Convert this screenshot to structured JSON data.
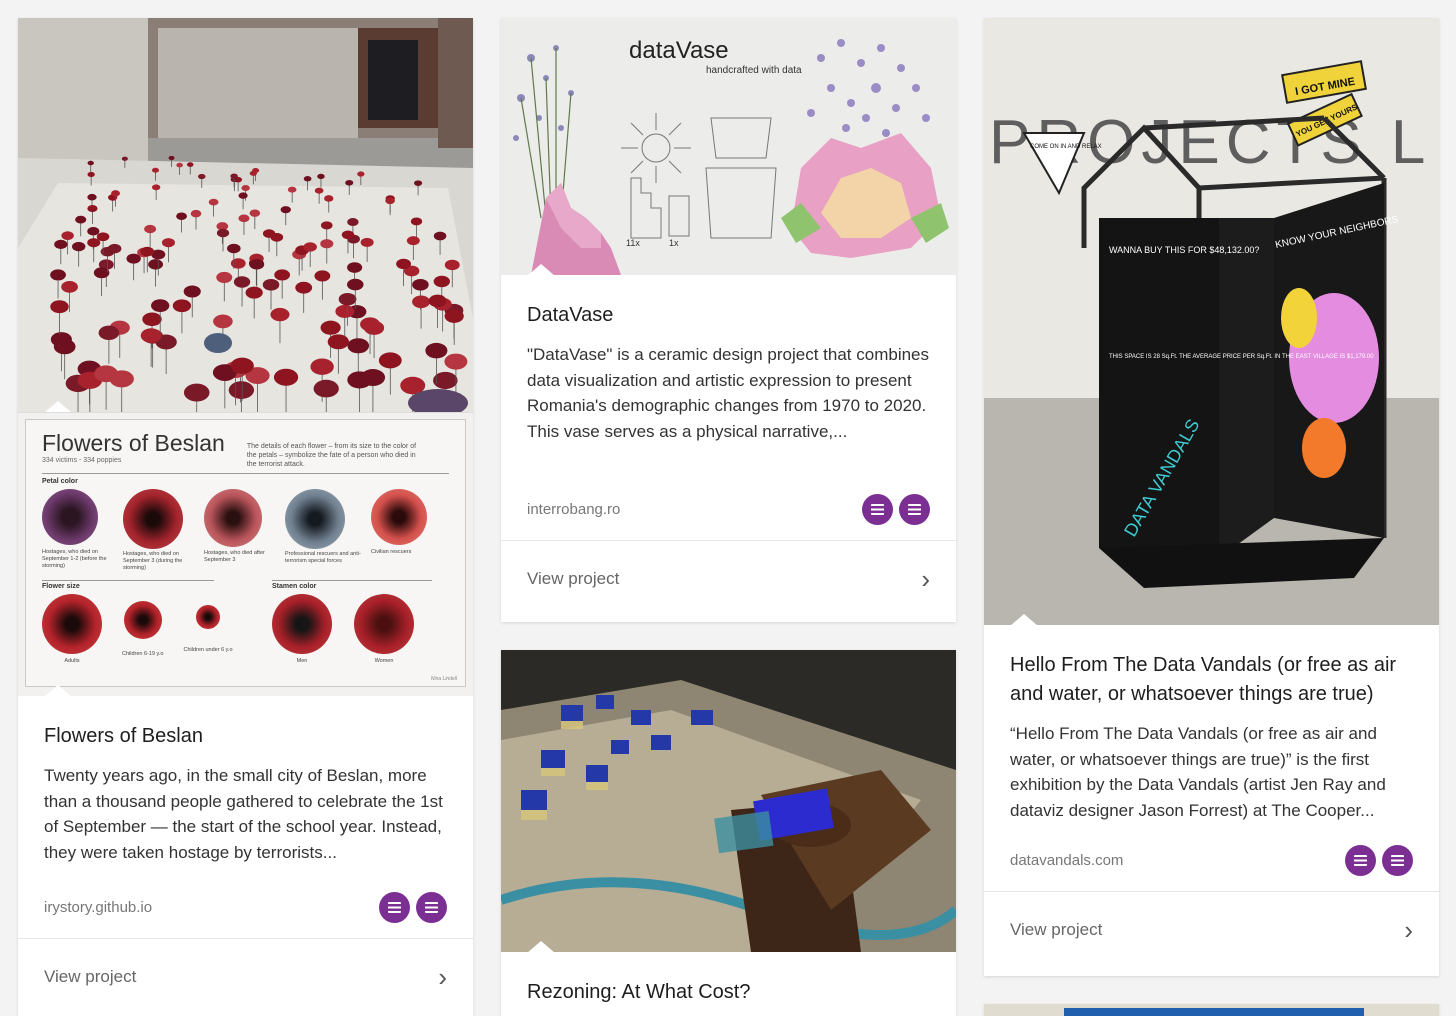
{
  "cards": [
    {
      "title": "Flowers of Beslan",
      "description": "Twenty years ago, in the small city of Beslan, more than a thousand people gathered to celebrate the 1st of September — the start of the school year. Instead, they were taken hostage by terrorists...",
      "source": "irystory.github.io",
      "view_label": "View project",
      "infographic": {
        "heading": "Flowers of Beslan",
        "subheading": "334 victims - 334 poppies",
        "note": "The details of each flower – from its size to the color of the petals – symbolize the fate of a person who died in the terrorist attack.",
        "petal_label": "Petal color",
        "size_label": "Flower size",
        "stamen_label": "Stamen color",
        "petal_items": [
          "Hostages, who died on September 1-2 (before the storming)",
          "Hostages, who died on September 3 (during the storming)",
          "Hostages, who died after September 3",
          "Professional rescuers and anti-terrorism special forces",
          "Civilian rescuers"
        ],
        "size_items": [
          "Adults",
          "Children 6-19 y.o",
          "Children under 6 y.o"
        ],
        "stamen_items": [
          "Men",
          "Women"
        ],
        "credit": "Nina Lindell"
      }
    },
    {
      "title": "DataVase",
      "description": "\"DataVase\" is a ceramic design project that combines data visualization and artistic expression to present Romania's demographic changes from 1970 to 2020. This vase serves as a physical narrative,...",
      "source": "interrobang.ro",
      "view_label": "View project",
      "image_text": {
        "logo": "dataVase",
        "tagline": "handcrafted with data",
        "count_a": "11x",
        "count_b": "1x"
      }
    },
    {
      "title": "Rezoning: At What Cost?"
    },
    {
      "title": "Hello From The Data Vandals (or free as air and water, or whatsoever things are true)",
      "description": "“Hello From The Data Vandals (or free as air and water, or whatsoever things are true)” is the first exhibition by the Data Vandals (artist Jen Ray and dataviz designer Jason Forrest) at The Cooper...",
      "source": "datavandals.com",
      "view_label": "View project",
      "image_text": {
        "wall": "PROJECTS L",
        "flag": "COME ON IN AND RELAX",
        "sign_a": "I GOT MINE",
        "sign_b": "YOU GET YOURS",
        "board": "WANNA BUY THIS FOR $48,132.00?",
        "board2": "THIS SPACE IS 28 Sq.Ft. THE AVERAGE PRICE PER Sq.Ft. IN THE EAST VILLAGE IS $1,179.00",
        "neighbors": "KNOW YOUR NEIGHBORS",
        "floor": "DATA VANDALS"
      }
    }
  ],
  "colors": {
    "badge": "#7c2f93",
    "background": "#f3f3f3"
  },
  "icons": {
    "badge": "list-icon",
    "chevron": "chevron-right-icon"
  }
}
